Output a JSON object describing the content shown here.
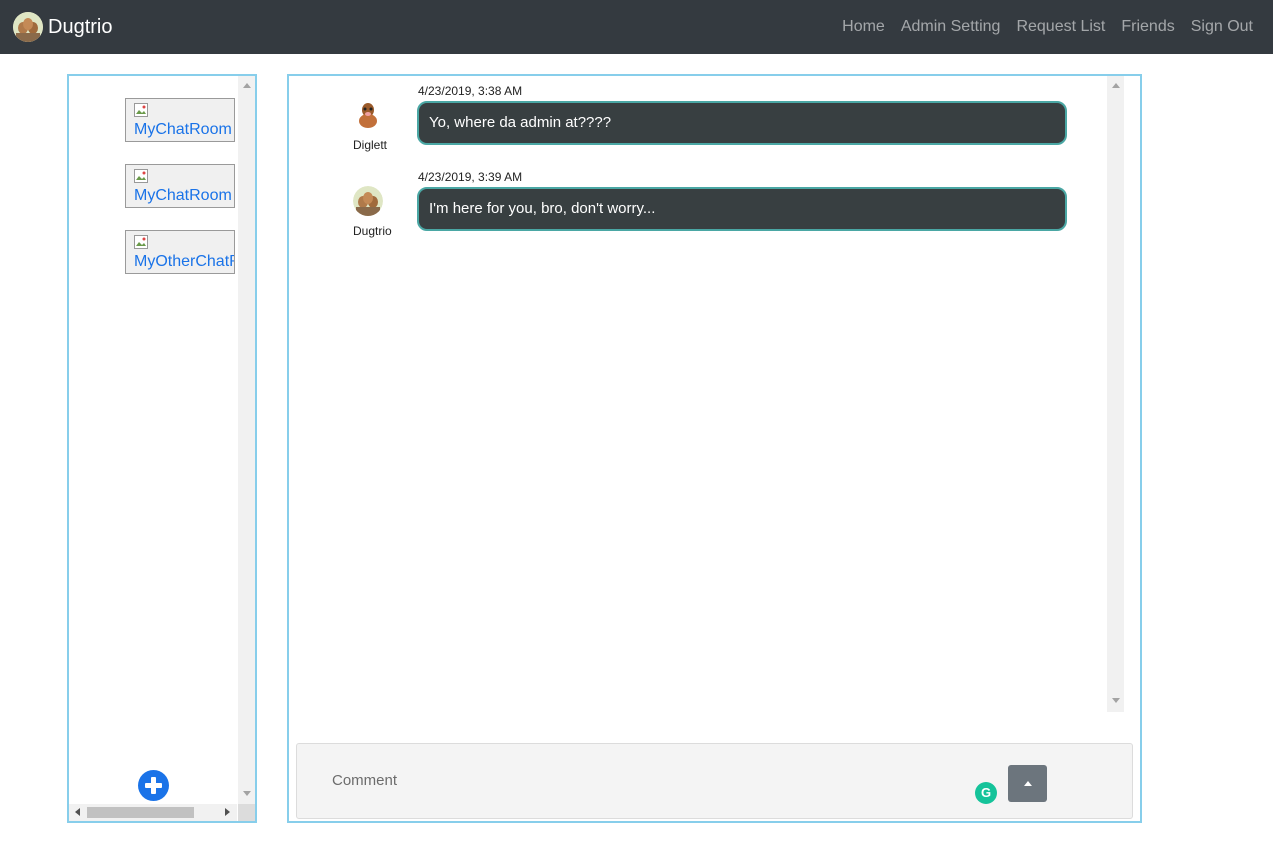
{
  "navbar": {
    "brand": "Dugtrio",
    "links": [
      "Home",
      "Admin Setting",
      "Request List",
      "Friends",
      "Sign Out"
    ]
  },
  "rooms": [
    {
      "label": "MyChatRoom"
    },
    {
      "label": "MyChatRoom"
    },
    {
      "label": "MyOtherChatRoom"
    }
  ],
  "messages": [
    {
      "time": "4/23/2019, 3:38 AM",
      "author": "Diglett",
      "text": "Yo, where da admin at????"
    },
    {
      "time": "4/23/2019, 3:39 AM",
      "author": "Dugtrio",
      "text": "I'm here for you, bro, don't worry..."
    }
  ],
  "comment": {
    "placeholder": "Comment",
    "value": ""
  },
  "icons": {
    "add": "plus-icon",
    "send": "caret-up-icon",
    "grammarly": "grammarly-icon"
  },
  "colors": {
    "navbar": "#343a40",
    "panel_border": "#87ceeb",
    "bubble": "#383f41",
    "bubble_border": "#4aa7a4",
    "link": "#1a73e8"
  }
}
